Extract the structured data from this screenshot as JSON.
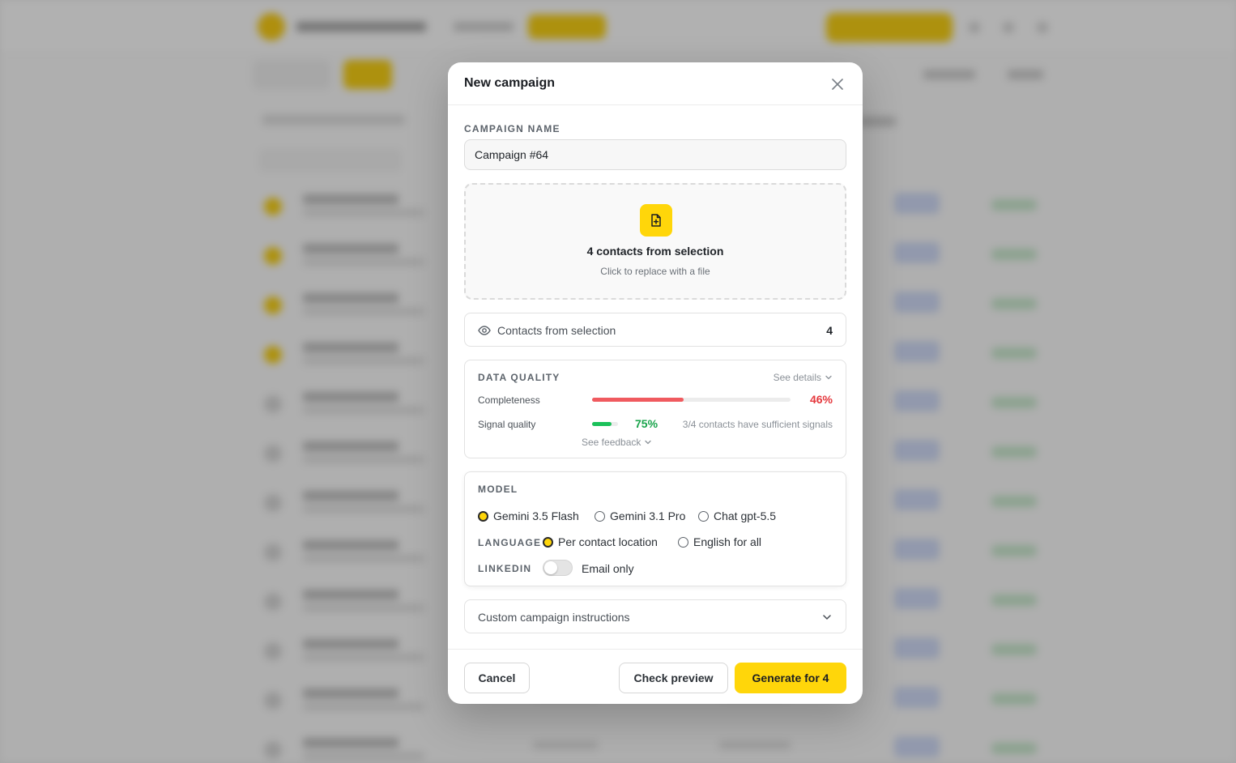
{
  "modal": {
    "title": "New campaign",
    "campaign_name": {
      "label": "CAMPAIGN NAME",
      "value": "Campaign #64"
    },
    "dropzone": {
      "icon": "file-plus-icon",
      "title": "4 contacts from selection",
      "subtitle": "Click to replace with a file"
    },
    "contacts": {
      "icon": "eye-icon",
      "label": "Contacts from selection",
      "count": "4"
    },
    "data_quality": {
      "label": "DATA QUALITY",
      "see_details": "See details",
      "completeness": {
        "label": "Completeness",
        "value": 0.46,
        "value_label": "46%"
      },
      "signal_quality": {
        "label": "Signal quality",
        "value": 0.75,
        "value_label": "75%",
        "note": "3/4 contacts have sufficient signals"
      },
      "see_feedback": "See feedback"
    },
    "model": {
      "label": "MODEL",
      "options": [
        {
          "label": "Gemini 3.5 Flash",
          "selected": true
        },
        {
          "label": "Gemini 3.1 Pro",
          "selected": false
        },
        {
          "label": "Chat gpt-5.5",
          "selected": false
        }
      ]
    },
    "language": {
      "label": "LANGUAGE",
      "options": [
        {
          "label": "Per contact location",
          "selected": true
        },
        {
          "label": "English for all",
          "selected": false
        }
      ]
    },
    "linkedin": {
      "label": "LINKEDIN",
      "enabled": false,
      "toggle_text": "Email only"
    },
    "custom_instructions": {
      "label": "Custom campaign instructions"
    },
    "footer": {
      "cancel": "Cancel",
      "preview": "Check preview",
      "generate": "Generate for 4"
    }
  },
  "colors": {
    "accent": "#ffd60a",
    "danger": "#e5383d",
    "success": "#17a34a"
  }
}
